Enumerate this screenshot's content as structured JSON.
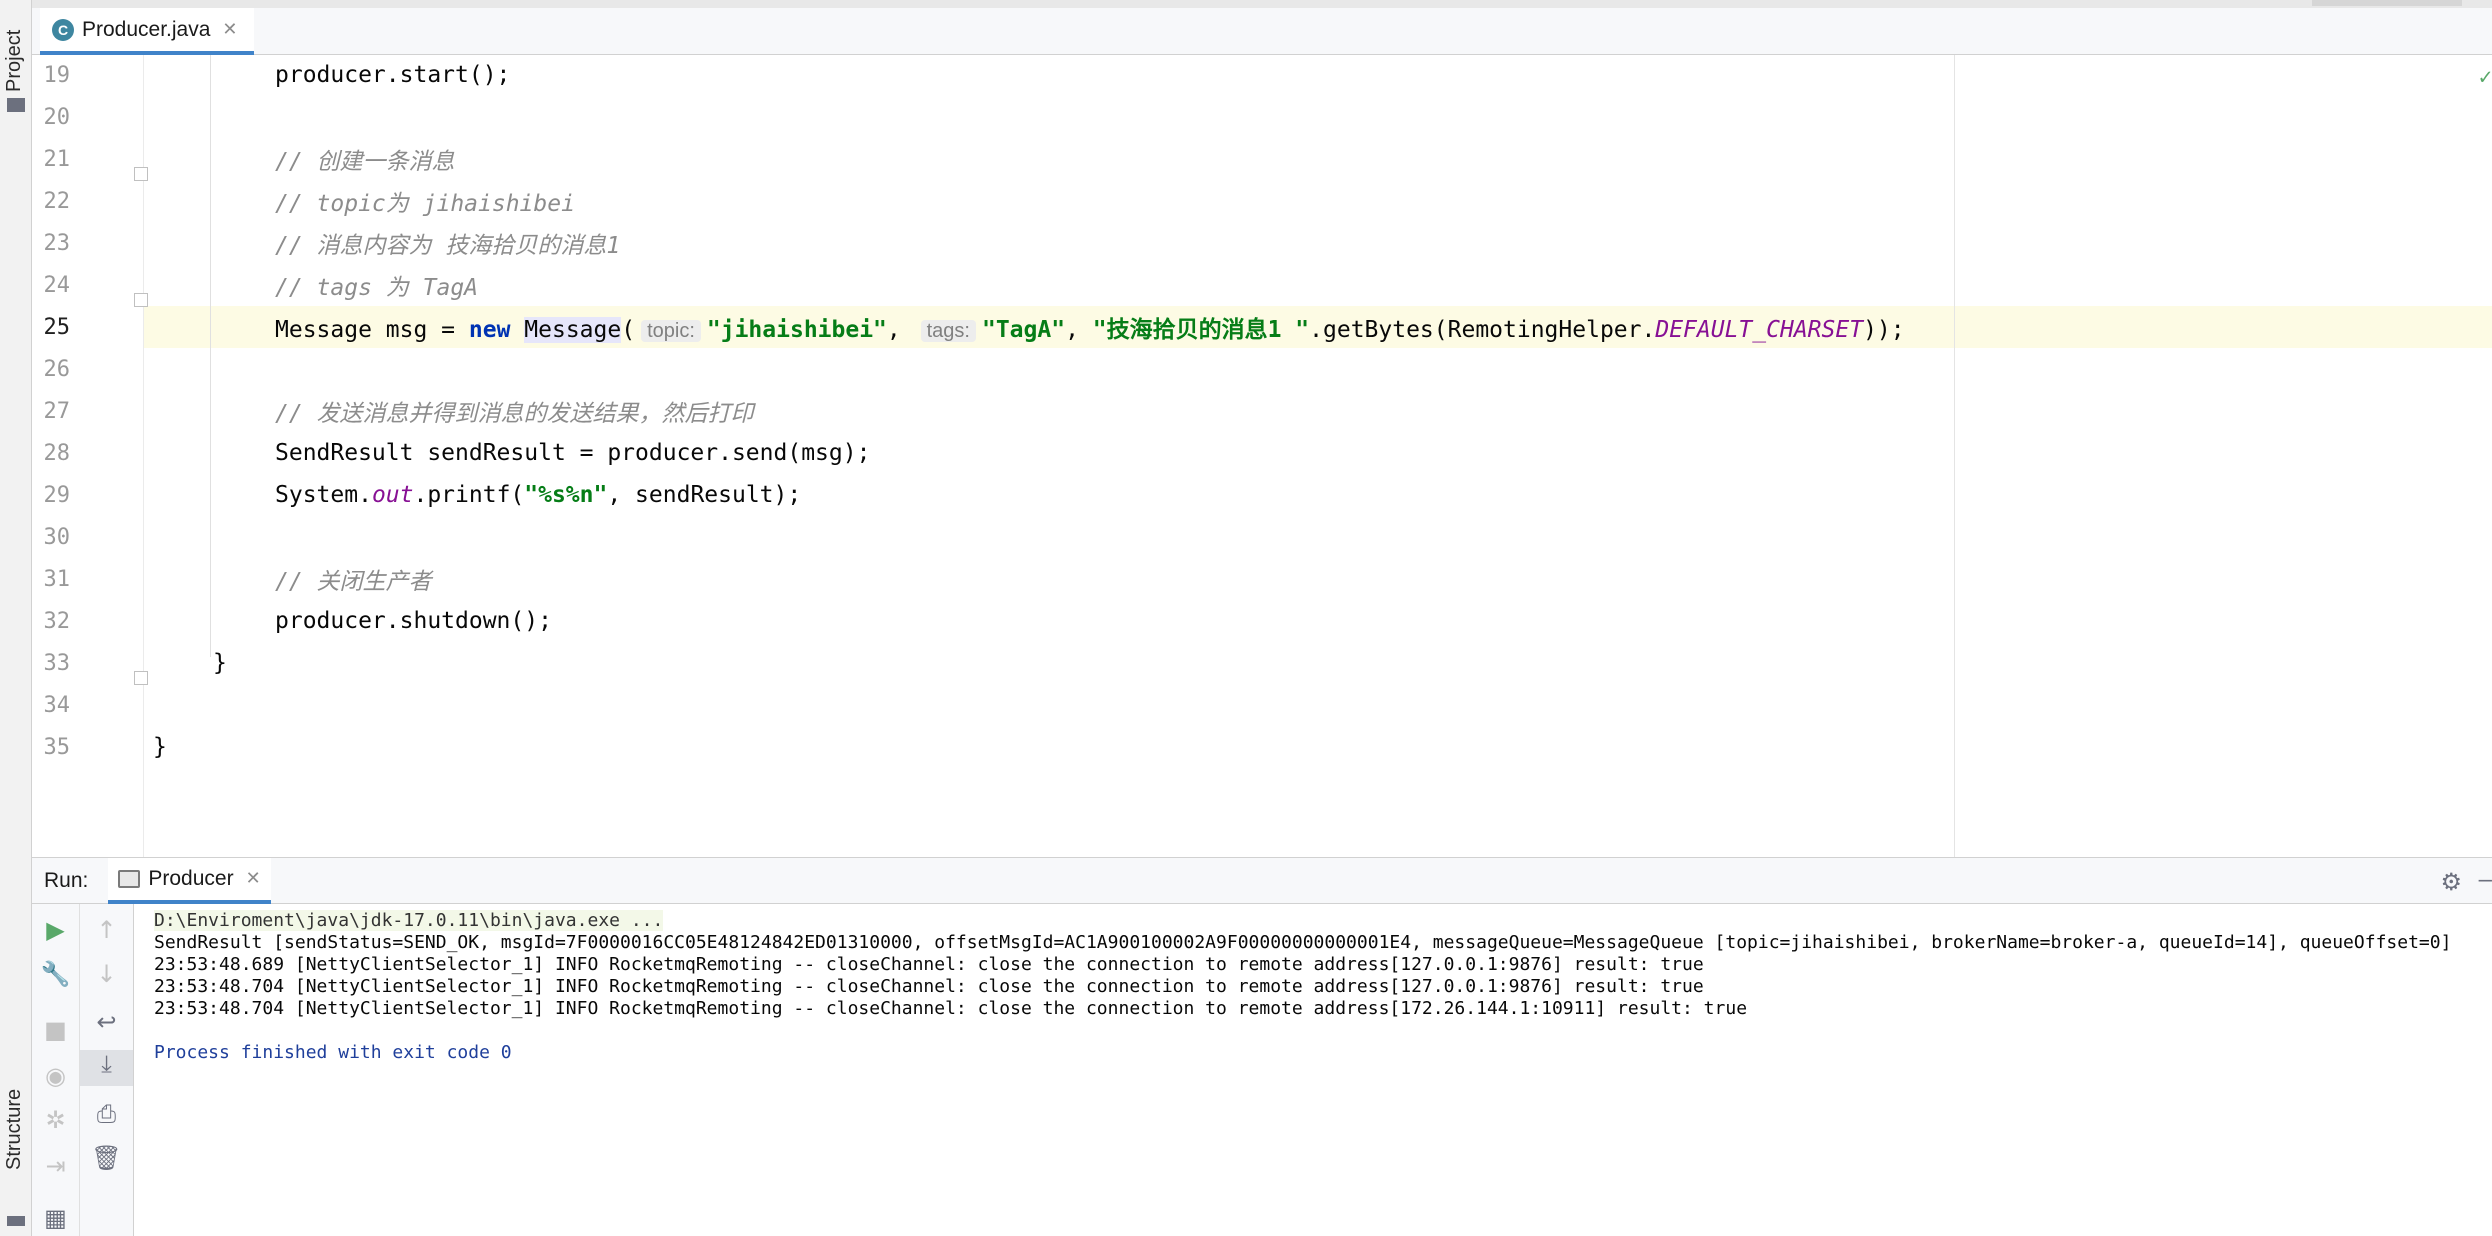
{
  "left_strip": {
    "project_label": "Project",
    "structure_label": "Structure"
  },
  "editor_tab": {
    "file_name": "Producer.java",
    "close_icon": "close-icon",
    "file_icon_letter": "C"
  },
  "colors": {
    "accent": "#4083c9",
    "keyword": "#0033b3",
    "string": "#067d17",
    "comment": "#8c8c8c",
    "static_field": "#871094",
    "current_line": "#fdfbe4",
    "exit_text": "#1f3f9b"
  },
  "code_lines": [
    {
      "num": "19",
      "parts": [
        [
          "plain",
          "producer.start();"
        ]
      ]
    },
    {
      "num": "20",
      "parts": []
    },
    {
      "num": "21",
      "parts": [
        [
          "cm",
          "// 创建一条消息"
        ]
      ]
    },
    {
      "num": "22",
      "parts": [
        [
          "cm",
          "// topic为 jihaishibei"
        ]
      ]
    },
    {
      "num": "23",
      "parts": [
        [
          "cm",
          "// 消息内容为 技海拾贝的消息1"
        ]
      ]
    },
    {
      "num": "24",
      "parts": [
        [
          "cm",
          "// tags 为 TagA"
        ]
      ]
    },
    {
      "num": "25",
      "parts": [
        [
          "plain",
          "Message msg = "
        ],
        [
          "kw",
          "new"
        ],
        [
          "plain",
          " "
        ],
        [
          "hl",
          "Message"
        ],
        [
          "plain",
          "("
        ],
        [
          "hint",
          "topic:"
        ],
        [
          "str",
          "\"jihaishibei\""
        ],
        [
          "plain",
          ", "
        ],
        [
          "hint",
          "tags:"
        ],
        [
          "str",
          "\"TagA\""
        ],
        [
          "plain",
          ", "
        ],
        [
          "str",
          "\"技海拾贝的消息1 \""
        ],
        [
          "plain",
          ".getBytes(RemotingHelper."
        ],
        [
          "static",
          "DEFAULT_CHARSET"
        ],
        [
          "plain",
          "));"
        ]
      ]
    },
    {
      "num": "26",
      "parts": []
    },
    {
      "num": "27",
      "parts": [
        [
          "cm",
          "// 发送消息并得到消息的发送结果，然后打印"
        ]
      ]
    },
    {
      "num": "28",
      "parts": [
        [
          "plain",
          "SendResult sendResult = producer.send(msg);"
        ]
      ]
    },
    {
      "num": "29",
      "parts": [
        [
          "plain",
          "System."
        ],
        [
          "static",
          "out"
        ],
        [
          "plain",
          ".printf("
        ],
        [
          "str",
          "\"%s%n\""
        ],
        [
          "plain",
          ", sendResult);"
        ]
      ]
    },
    {
      "num": "30",
      "parts": []
    },
    {
      "num": "31",
      "parts": [
        [
          "cm",
          "// 关闭生产者"
        ]
      ]
    },
    {
      "num": "32",
      "parts": [
        [
          "plain",
          "producer.shutdown();"
        ]
      ]
    },
    {
      "num": "33",
      "parts": [
        [
          "plain",
          "}"
        ]
      ]
    },
    {
      "num": "34",
      "parts": []
    },
    {
      "num": "35",
      "parts": [
        [
          "plain",
          "}"
        ]
      ]
    }
  ],
  "run_panel": {
    "label": "Run:",
    "tab_name": "Producer",
    "console_lines": [
      {
        "kind": "cmd",
        "text": "D:\\Enviroment\\java\\jdk-17.0.11\\bin\\java.exe ..."
      },
      {
        "kind": "out",
        "text": "SendResult [sendStatus=SEND_OK, msgId=7F0000016CC05E48124842ED01310000, offsetMsgId=AC1A900100002A9F00000000000001E4, messageQueue=MessageQueue [topic=jihaishibei, brokerName=broker-a, queueId=14], queueOffset=0]"
      },
      {
        "kind": "out",
        "text": "23:53:48.689 [NettyClientSelector_1] INFO RocketmqRemoting -- closeChannel: close the connection to remote address[127.0.0.1:9876] result: true"
      },
      {
        "kind": "out",
        "text": "23:53:48.704 [NettyClientSelector_1] INFO RocketmqRemoting -- closeChannel: close the connection to remote address[127.0.0.1:9876] result: true"
      },
      {
        "kind": "out",
        "text": "23:53:48.704 [NettyClientSelector_1] INFO RocketmqRemoting -- closeChannel: close the connection to remote address[172.26.144.1:10911] result: true"
      },
      {
        "kind": "blank",
        "text": ""
      },
      {
        "kind": "exit",
        "text": "Process finished with exit code 0"
      }
    ]
  }
}
